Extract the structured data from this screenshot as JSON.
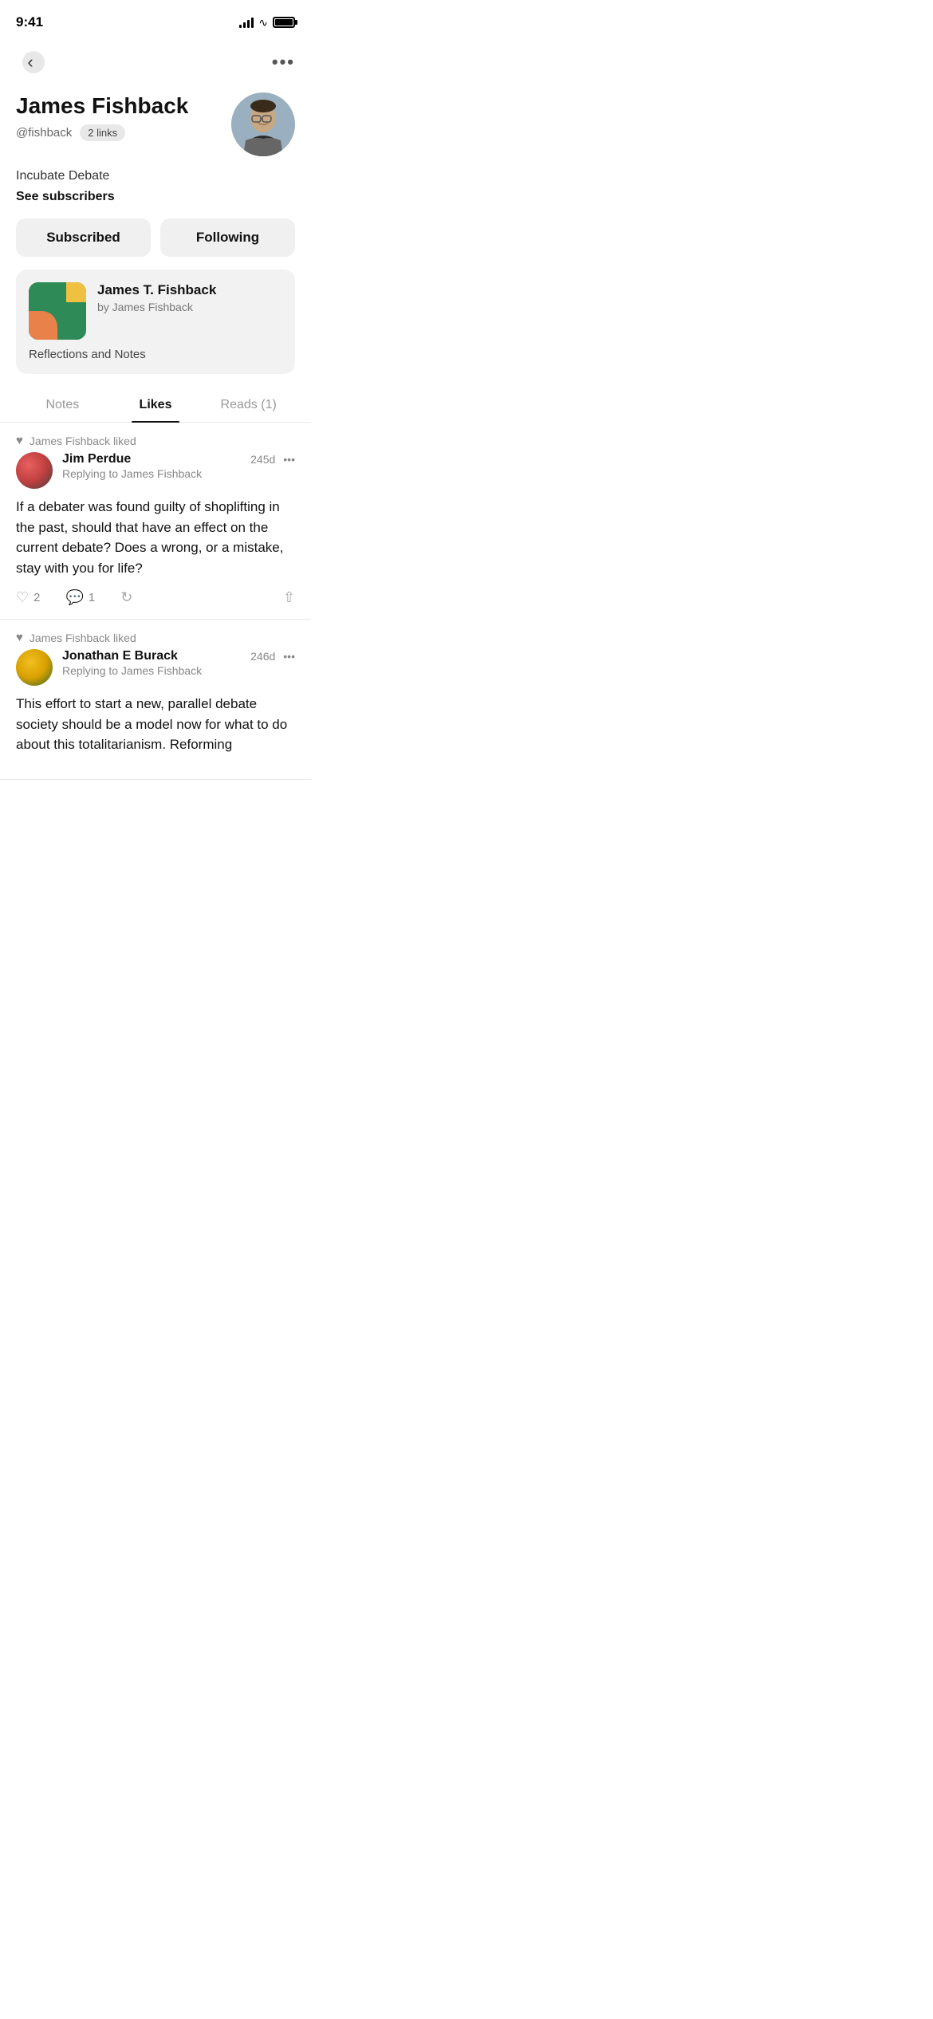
{
  "statusBar": {
    "time": "9:41",
    "batteryFull": true
  },
  "header": {
    "backLabel": "‹",
    "moreLabel": "•••"
  },
  "profile": {
    "name": "James Fishback",
    "handle": "@fishback",
    "links": "2 links",
    "bio": "Incubate Debate",
    "seeSubscribers": "See subscribers"
  },
  "buttons": {
    "subscribed": "Subscribed",
    "following": "Following"
  },
  "newsletter": {
    "title": "James T. Fishback",
    "author": "by James Fishback",
    "description": "Reflections and Notes"
  },
  "tabs": {
    "notes": "Notes",
    "likes": "Likes",
    "reads": "Reads (1)"
  },
  "posts": [
    {
      "likedBy": "James Fishback liked",
      "author": "Jim Perdue",
      "time": "245d",
      "replyingTo": "Replying to James Fishback",
      "body": "If a debater was found guilty of shoplifting in the past, should that have an effect on the current debate? Does a wrong, or a mistake, stay with you for life?",
      "likes": "2",
      "comments": "1",
      "avatarType": "jim"
    },
    {
      "likedBy": "James Fishback liked",
      "author": "Jonathan E Burack",
      "time": "246d",
      "replyingTo": "Replying to James Fishback",
      "body": "This effort to start a new, parallel debate society should be a model now for what to do about this totalitarianism. Reforming",
      "likes": "",
      "comments": "",
      "avatarType": "jonathan"
    }
  ]
}
